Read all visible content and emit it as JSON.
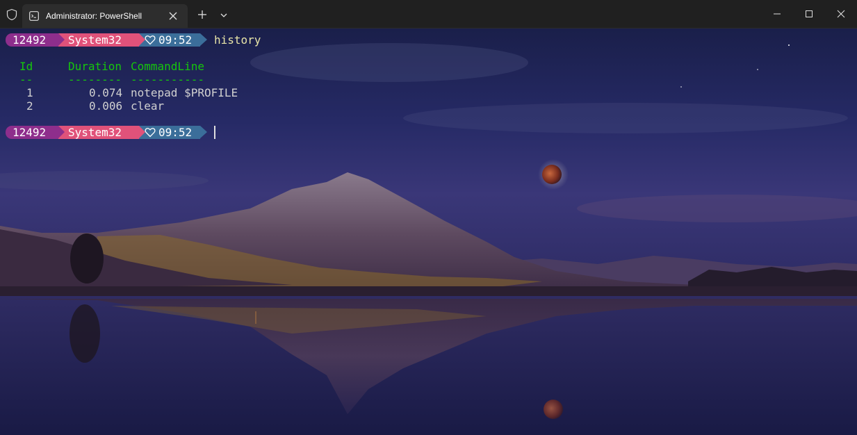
{
  "window": {
    "tab_title": "Administrator: PowerShell"
  },
  "prompts": [
    {
      "pid": "12492",
      "dir": "System32",
      "time": "09:52",
      "command": "history"
    },
    {
      "pid": "12492",
      "dir": "System32",
      "time": "09:52",
      "command": ""
    }
  ],
  "history_table": {
    "headers": [
      "Id",
      "Duration",
      "CommandLine"
    ],
    "underline": [
      "--",
      "--------",
      "-----------"
    ],
    "rows": [
      {
        "id": "1",
        "duration": "0.074",
        "command": "notepad $PROFILE"
      },
      {
        "id": "2",
        "duration": "0.006",
        "command": "clear"
      }
    ]
  },
  "colors": {
    "pid_segment": "#8e2e8c",
    "dir_segment": "#e0527a",
    "time_segment": "#3b6e9a",
    "command_text": "#e8e5a8",
    "table_header": "#16c60c"
  },
  "icons": {
    "titlebar": "shield-icon",
    "tab": "terminal-icon",
    "time_segment": "heart-icon"
  }
}
